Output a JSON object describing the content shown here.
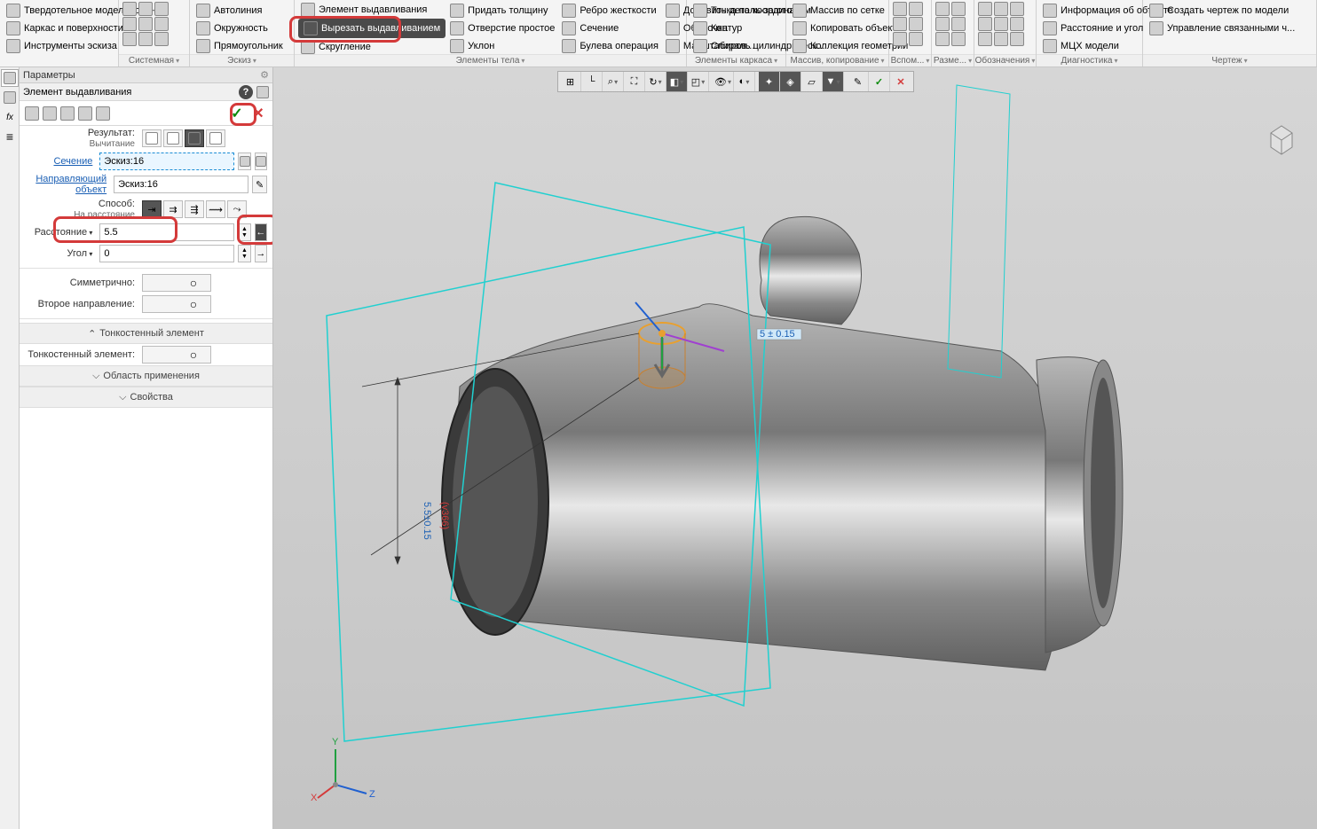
{
  "ribbon": {
    "groups": {
      "mode": {
        "solid": "Твердотельное моделирование",
        "wireframe": "Каркас и поверхности",
        "sketch_tools": "Инструменты эскиза"
      },
      "system": "Системная",
      "sketch": {
        "label": "Эскиз",
        "autoline": "Автолиния",
        "circle": "Окружность",
        "rect": "Прямоугольник"
      },
      "body": {
        "label": "Элементы тела",
        "extrude": "Элемент выдавливания",
        "cut_extrude": "Вырезать выдавливанием",
        "fillet": "Скругление",
        "thicken": "Придать толщину",
        "hole": "Отверстие простое",
        "draft": "Уклон",
        "rib": "Ребро жесткости",
        "section": "Сечение",
        "bool": "Булева операция",
        "add_part": "Добавить деталь-загото...",
        "shell": "Оболочка",
        "scale": "Масштабиров..."
      },
      "wireframe": {
        "label": "Элементы каркаса",
        "point": "Точка по координатам",
        "contour": "Контур",
        "spiral": "Спираль цилиндрическ..."
      },
      "array": {
        "label": "Массив, копирование",
        "grid_array": "Массив по сетке",
        "copy_obj": "Копировать объекты",
        "geom_coll": "Коллекция геометрии"
      },
      "aux": {
        "label": "Вспом..."
      },
      "dim": {
        "label": "Разме..."
      },
      "annot": {
        "label": "Обозначения"
      },
      "diag": {
        "label": "Диагностика",
        "info": "Информация об объекте",
        "dist_angle": "Расстояние и угол",
        "mcx": "МЦХ модели"
      },
      "drawing": {
        "label": "Чертеж",
        "create": "Создать чертеж по модели",
        "manage": "Управление связанными ч..."
      }
    }
  },
  "panel": {
    "title": "Параметры",
    "subtitle": "Элемент выдавливания",
    "result_label": "Результат:",
    "result_value": "Вычитание",
    "section_label": "Сечение",
    "section_value": "Эскиз:16",
    "guide_label": "Направляющий объект",
    "guide_value": "Эскиз:16",
    "method_label": "Способ:",
    "method_value": "На расстояние",
    "distance_label": "Расстояние",
    "distance_value": "5.5",
    "angle_label": "Угол",
    "angle_value": "0",
    "symmetric_label": "Симметрично:",
    "second_dir_label": "Второе направление:",
    "thin_section": "Тонкостенный элемент",
    "thin_label": "Тонкостенный элемент:",
    "scope_section": "Область применения",
    "props_section": "Свойства"
  },
  "viewport": {
    "dim_main": "5.5±0.15",
    "dim_ref": "(v366)",
    "dim_small": "5 ± 0.15"
  }
}
